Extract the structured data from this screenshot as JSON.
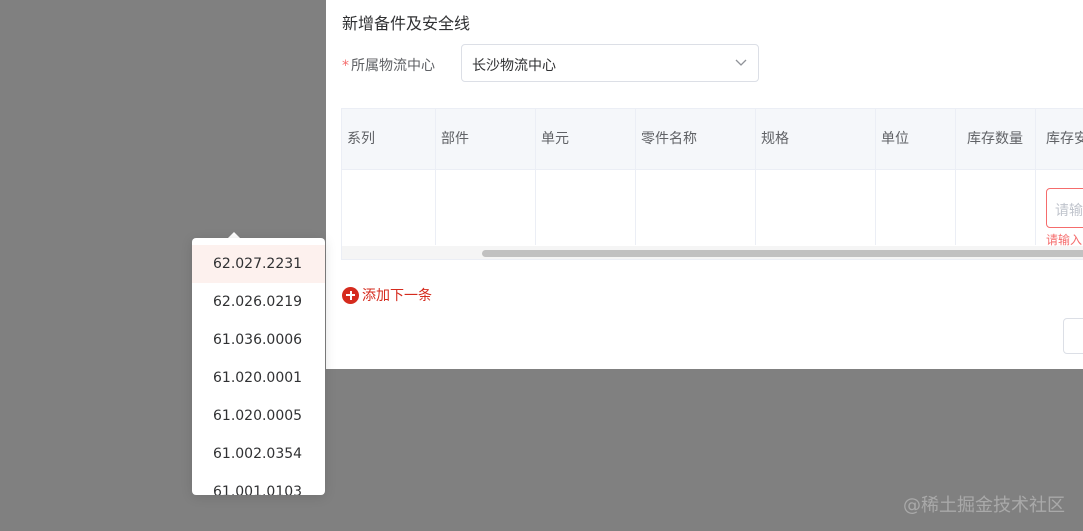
{
  "dialog": {
    "title": "新增备件及安全线",
    "form": {
      "required_mark": "*",
      "label": "所属物流中心",
      "value": "长沙物流中心"
    },
    "table": {
      "columns": [
        "系列",
        "部件",
        "单元",
        "零件名称",
        "规格",
        "单位",
        "库存数量",
        "库存安"
      ],
      "input_placeholder": "请输",
      "error_text": "请输入"
    },
    "add_next_label": "添加下一条"
  },
  "dropdown": {
    "items": [
      "62.027.2231",
      "62.026.0219",
      "61.036.0006",
      "61.020.0001",
      "61.020.0005",
      "61.002.0354",
      "61.001.0103"
    ],
    "active_index": 0
  },
  "watermark": "@稀土掘金技术社区",
  "icons": {
    "select_arrow": "chevron-down-icon",
    "add": "plus-circle-icon"
  },
  "colors": {
    "accent": "#d52b1e",
    "error": "#f56c6c",
    "overlay": "#808080",
    "dropdown_active": "#fdf1ee"
  }
}
